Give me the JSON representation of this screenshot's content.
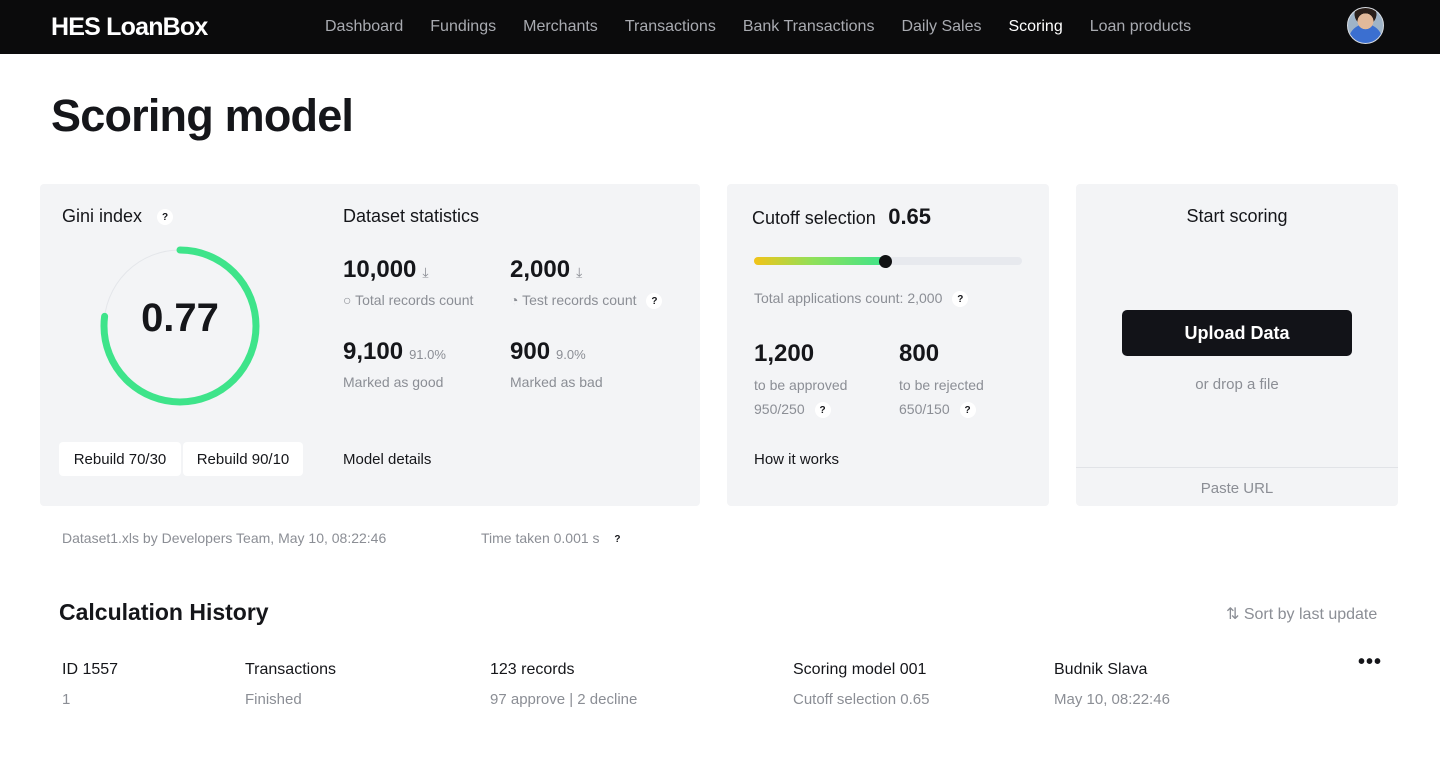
{
  "brand": {
    "logo": "HES LoanBox"
  },
  "nav": {
    "items": [
      "Dashboard",
      "Fundings",
      "Merchants",
      "Transactions",
      "Bank Transactions",
      "Daily Sales",
      "Scoring",
      "Loan products"
    ],
    "active": "Scoring"
  },
  "page": {
    "title": "Scoring model"
  },
  "gini": {
    "heading": "Gini index",
    "help": "?",
    "value": "0.77",
    "ring_fraction": 0.77,
    "ring_color": "#3ee48a",
    "rebuild_a": "Rebuild 70/30",
    "rebuild_b": "Rebuild 90/10"
  },
  "dataset": {
    "heading": "Dataset statistics",
    "total_value": "10,000",
    "total_label": "Total records count",
    "test_value": "2,000",
    "test_label": "Test records count",
    "good_value": "9,100",
    "good_pct": "91.0%",
    "good_label": "Marked as good",
    "bad_value": "900",
    "bad_pct": "9.0%",
    "bad_label": "Marked as bad",
    "model_details": "Model details"
  },
  "cutoff": {
    "heading": "Cutoff selection",
    "value": "0.65",
    "slider_fraction": 0.49,
    "total_apps": "Total applications count: 2,000",
    "approved_value": "1,200",
    "approved_label": "to be approved",
    "approved_split": "950/250",
    "rejected_value": "800",
    "rejected_label": "to be rejected",
    "rejected_split": "650/150",
    "how_it_works": "How it works"
  },
  "start": {
    "heading": "Start scoring",
    "upload": "Upload Data",
    "drop": "or drop a file",
    "paste": "Paste URL"
  },
  "meta": {
    "dataset_info": "Dataset1.xls by Developers Team, May 10, 08:22:46",
    "time_taken": "Time taken 0.001 s"
  },
  "history": {
    "title": "Calculation History",
    "sort": "Sort by last update",
    "rows": [
      {
        "id": "ID 1557",
        "id_sub": "1",
        "type": "Transactions",
        "status": "Finished",
        "records": "123 records",
        "records_sub": "97 approve | 2 decline",
        "model": "Scoring model 001",
        "model_sub": "Cutoff selection 0.65",
        "user": "Budnik Slava",
        "date": "May 10, 08:22:46"
      }
    ]
  }
}
